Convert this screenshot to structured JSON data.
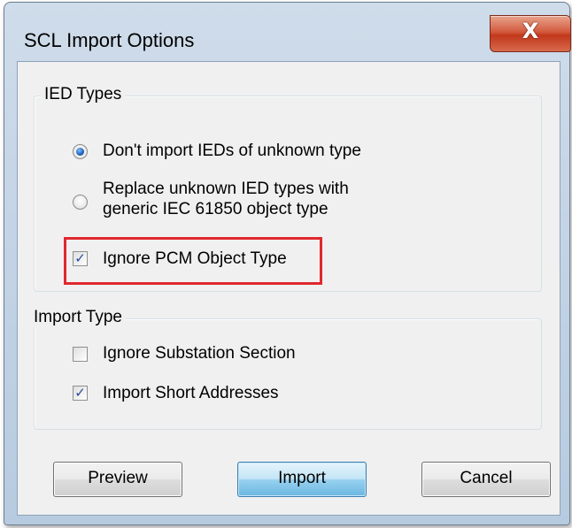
{
  "window": {
    "title": "SCL Import Options",
    "close_label": "X"
  },
  "ied_types": {
    "legend": "IED Types",
    "options": [
      {
        "label": "Don't import IEDs of unknown type",
        "checked": true
      },
      {
        "label_line1": "Replace unknown IED types with",
        "label_line2": "generic IEC 61850 object type",
        "checked": false
      }
    ],
    "ignore_pcm": {
      "label": "Ignore PCM Object Type",
      "checked": true
    }
  },
  "import_type": {
    "legend": "Import Type",
    "ignore_substation": {
      "label": "Ignore Substation Section",
      "checked": false
    },
    "import_short_addresses": {
      "label": "Import Short Addresses",
      "checked": true
    }
  },
  "buttons": {
    "preview": "Preview",
    "import": "Import",
    "cancel": "Cancel"
  },
  "colors": {
    "highlight": "#e0282e",
    "check_mark": "#2a4a9a",
    "radio_dot": "#1e5cb8"
  },
  "icons": {
    "check": "✓"
  }
}
